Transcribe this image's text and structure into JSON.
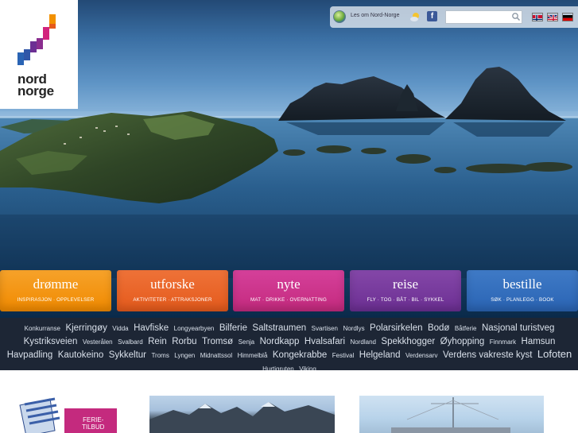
{
  "header": {
    "logo_text": [
      "nord",
      "norge"
    ],
    "about_link": "Les om Nord-Norge",
    "search": {
      "placeholder": "",
      "value": ""
    },
    "languages": [
      "norwegian-flag",
      "uk-flag",
      "german-flag"
    ],
    "icons": [
      "globe-icon",
      "weather-icon",
      "facebook-icon",
      "search-icon"
    ]
  },
  "nav": [
    {
      "title": "drømme",
      "subtitle": "INSPIRASJON · OPPLEVELSER",
      "color": "#f18a00"
    },
    {
      "title": "utforske",
      "subtitle": "AKTIVITETER · ATTRAKSJONER",
      "color": "#e55a1c"
    },
    {
      "title": "nyte",
      "subtitle": "MAT · DRIKKE · OVERNATTING",
      "color": "#c42a7e"
    },
    {
      "title": "reise",
      "subtitle": "FLY · TOG · BÅT · BIL · SYKKEL",
      "color": "#6c2f93"
    },
    {
      "title": "bestille",
      "subtitle": "SØK · PLANLEGG · BOOK",
      "color": "#2a64b4"
    }
  ],
  "tags": [
    {
      "text": "Konkurranse",
      "size": 1
    },
    {
      "text": "Kjerringøy",
      "size": 3
    },
    {
      "text": "Vidda",
      "size": 1
    },
    {
      "text": "Havfiske",
      "size": 3
    },
    {
      "text": "Longyearbyen",
      "size": 1
    },
    {
      "text": "Bilferie",
      "size": 3
    },
    {
      "text": "Saltstraumen",
      "size": 3
    },
    {
      "text": "Svartisen",
      "size": 1
    },
    {
      "text": "Nordlys",
      "size": 1
    },
    {
      "text": "Polarsirkelen",
      "size": 3
    },
    {
      "text": "Bodø",
      "size": 3
    },
    {
      "text": "Båtferie",
      "size": 1
    },
    {
      "text": "Nasjonal turistveg",
      "size": 3
    },
    {
      "text": "Kystriksveien",
      "size": 3
    },
    {
      "text": "Vesterålen",
      "size": 1
    },
    {
      "text": "Svalbard",
      "size": 1
    },
    {
      "text": "Rein",
      "size": 3
    },
    {
      "text": "Rorbu",
      "size": 3
    },
    {
      "text": "Tromsø",
      "size": 3
    },
    {
      "text": "Senja",
      "size": 1
    },
    {
      "text": "Nordkapp",
      "size": 3
    },
    {
      "text": "Hvalsafari",
      "size": 3
    },
    {
      "text": "Nordland",
      "size": 1
    },
    {
      "text": "Spekkhogger",
      "size": 3
    },
    {
      "text": "Øyhopping",
      "size": 3
    },
    {
      "text": "Finnmark",
      "size": 1
    },
    {
      "text": "Hamsun",
      "size": 3
    },
    {
      "text": "Havpadling",
      "size": 3
    },
    {
      "text": "Kautokeino",
      "size": 3
    },
    {
      "text": "Sykkeltur",
      "size": 3
    },
    {
      "text": "Troms",
      "size": 1
    },
    {
      "text": "Lyngen",
      "size": 1
    },
    {
      "text": "Midnattssol",
      "size": 1
    },
    {
      "text": "Himmelblå",
      "size": 1
    },
    {
      "text": "Kongekrabbe",
      "size": 3
    },
    {
      "text": "Festival",
      "size": 1
    },
    {
      "text": "Helgeland",
      "size": 3
    },
    {
      "text": "Verdensarv",
      "size": 1
    },
    {
      "text": "Verdens vakreste kyst",
      "size": 3
    },
    {
      "text": "Lofoten",
      "size": 4
    },
    {
      "text": "Hurtigruten",
      "size": 1
    },
    {
      "text": "Viking",
      "size": 1
    }
  ],
  "promo": {
    "badge_line1": "FERIE-",
    "badge_line2": "TILBUD"
  }
}
